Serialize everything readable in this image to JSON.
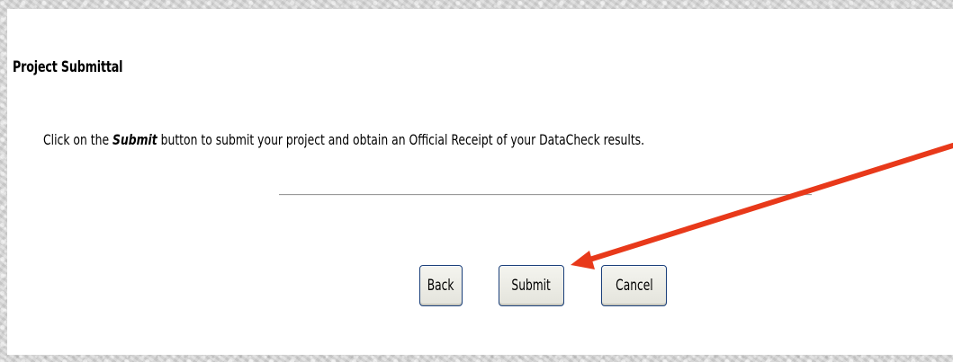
{
  "page": {
    "title": "Project Submittal",
    "instructions": {
      "before": "Click on the ",
      "keyword": "Submit",
      "after": " button to submit your project and obtain an Official Receipt of your DataCheck results."
    }
  },
  "buttons": {
    "back_label": "Back",
    "submit_label": "Submit",
    "cancel_label": "Cancel"
  },
  "colors": {
    "annotation_arrow": "#e8391a",
    "button_border": "#1a3f7a"
  }
}
